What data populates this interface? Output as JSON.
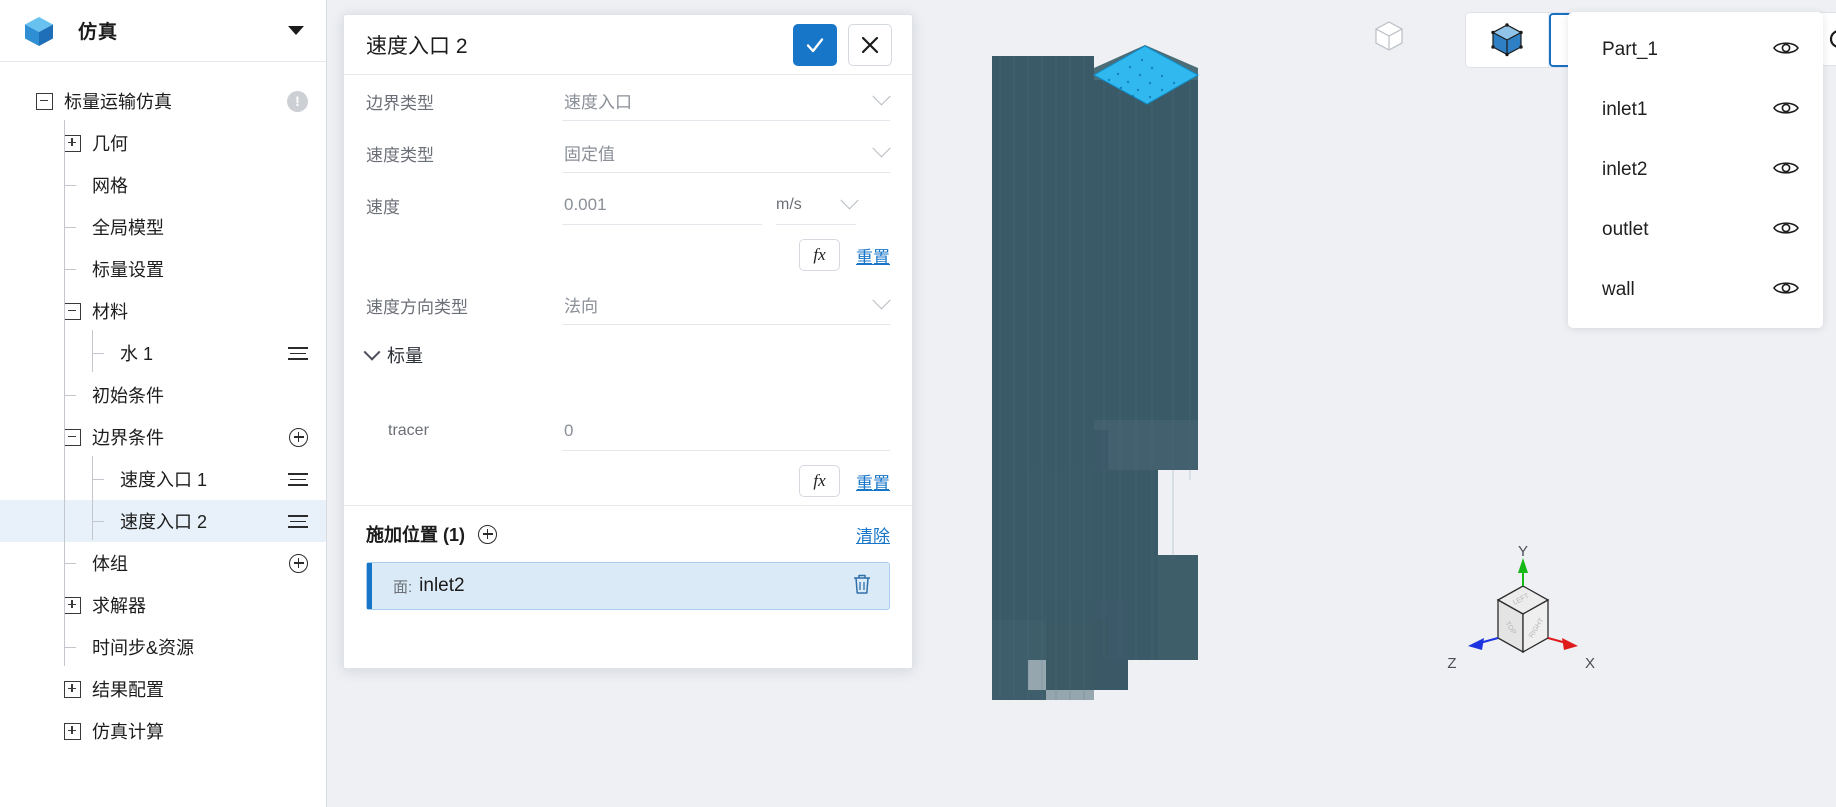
{
  "sidebar": {
    "title": "仿真",
    "logo_icon": "cube-logo-icon",
    "caret_icon": "caret-down-icon",
    "tree": [
      {
        "label": "标量运输仿真",
        "level": 0,
        "marker": "minus",
        "right": "warn",
        "selected": false
      },
      {
        "label": "几何",
        "level": 1,
        "marker": "plus",
        "right": "none",
        "selected": false
      },
      {
        "label": "网格",
        "level": 1,
        "marker": "stub",
        "right": "none",
        "selected": false
      },
      {
        "label": "全局模型",
        "level": 1,
        "marker": "stub",
        "right": "none",
        "selected": false
      },
      {
        "label": "标量设置",
        "level": 1,
        "marker": "stub",
        "right": "none",
        "selected": false
      },
      {
        "label": "材料",
        "level": 1,
        "marker": "minus",
        "right": "none",
        "selected": false
      },
      {
        "label": "水 1",
        "level": 2,
        "marker": "stub",
        "right": "menu",
        "selected": false
      },
      {
        "label": "初始条件",
        "level": 1,
        "marker": "stub",
        "right": "none",
        "selected": false
      },
      {
        "label": "边界条件",
        "level": 1,
        "marker": "minus",
        "right": "add",
        "selected": false
      },
      {
        "label": "速度入口 1",
        "level": 2,
        "marker": "stub",
        "right": "menu",
        "selected": false
      },
      {
        "label": "速度入口 2",
        "level": 2,
        "marker": "stub",
        "right": "menu",
        "selected": true
      },
      {
        "label": "体组",
        "level": 1,
        "marker": "stub",
        "right": "add",
        "selected": false
      },
      {
        "label": "求解器",
        "level": 1,
        "marker": "plus",
        "right": "none",
        "selected": false
      },
      {
        "label": "时间步&资源",
        "level": 1,
        "marker": "stub",
        "right": "none",
        "selected": false
      },
      {
        "label": "结果配置",
        "level": 1,
        "marker": "plus",
        "right": "none",
        "selected": false
      },
      {
        "label": "仿真计算",
        "level": 1,
        "marker": "plus",
        "right": "none",
        "selected": false
      }
    ]
  },
  "dialog": {
    "title": "速度入口 2",
    "confirm_icon": "check-icon",
    "cancel_icon": "close-icon",
    "fields": [
      {
        "label": "边界类型",
        "value": "速度入口",
        "control": "select"
      },
      {
        "label": "速度类型",
        "value": "固定值",
        "control": "select"
      },
      {
        "label": "速度",
        "value": "0.001",
        "control": "input",
        "unit": "m/s"
      },
      {
        "label": "速度方向类型",
        "value": "法向",
        "control": "select"
      }
    ],
    "fx_label": "fx",
    "reset_label": "重置",
    "scalar_section": {
      "title": "标量",
      "expanded": true,
      "rows": [
        {
          "label": "tracer",
          "value": "0"
        }
      ]
    },
    "location": {
      "title": "施加位置 (1)",
      "add_icon": "plus-circle-icon",
      "clear_label": "清除",
      "items": [
        {
          "kind": "面:",
          "name": "inlet2",
          "delete_icon": "trash-icon",
          "selected": true
        }
      ]
    }
  },
  "viewport": {
    "toolbar": {
      "plain_cube_icon": "cube-outline-icon",
      "modes": [
        {
          "name": "body-select",
          "icon": "cube-solid-icon",
          "active": false
        },
        {
          "name": "face-select",
          "icon": "cube-face-icon",
          "active": true
        },
        {
          "name": "edge-select",
          "icon": "cube-edge-icon",
          "active": false
        },
        {
          "name": "vertex-select",
          "icon": "cube-vertex-icon",
          "active": false
        }
      ],
      "reset_icon": "rotate-reset-icon"
    },
    "parts": [
      {
        "name": "Part_1",
        "eye_icon": "eye-icon",
        "visible": true
      },
      {
        "name": "inlet1",
        "eye_icon": "eye-icon",
        "visible": true
      },
      {
        "name": "inlet2",
        "eye_icon": "eye-icon",
        "visible": true
      },
      {
        "name": "outlet",
        "eye_icon": "eye-icon",
        "visible": true
      },
      {
        "name": "wall",
        "eye_icon": "eye-icon",
        "visible": true
      }
    ],
    "viewcube": {
      "axis_x": "X",
      "axis_y": "Y",
      "axis_z": "Z",
      "face_top": "TOP",
      "face_left": "LEFT",
      "face_right": "RIGHT"
    }
  },
  "colors": {
    "accent": "#1876c8",
    "mesh_body": "#3b5a68",
    "mesh_highlight": "#30b8ef",
    "axis_x": "#e01b1b",
    "axis_y": "#16b816",
    "axis_z": "#1b34e0",
    "panel_bg": "#ffffff",
    "canvas_bg": "#eef0f4"
  }
}
